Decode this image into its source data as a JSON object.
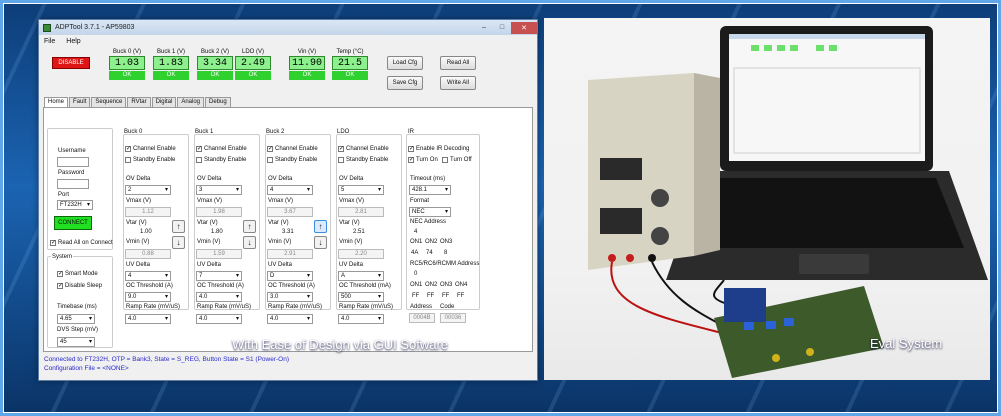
{
  "window": {
    "title": "ADPTool 3.7.1 - AP59803"
  },
  "menu": [
    "File",
    "Help"
  ],
  "top": {
    "disable_label": "DISABLE",
    "meters": [
      {
        "label": "Buck 0 (V)",
        "value": "1.03",
        "status": "OK"
      },
      {
        "label": "Buck 1 (V)",
        "value": "1.83",
        "status": "OK"
      },
      {
        "label": "Buck 2 (V)",
        "value": "3.34",
        "status": "OK"
      },
      {
        "label": "LDO (V)",
        "value": "2.49",
        "status": "OK"
      },
      {
        "label": "Vin (V)",
        "value": "11.90",
        "status": "OK"
      },
      {
        "label": "Temp (°C)",
        "value": "21.5",
        "status": "OK"
      }
    ],
    "load_cfg": "Load Cfg",
    "save_cfg": "Save Cfg",
    "read_all": "Read All",
    "write_all": "Write All"
  },
  "tabs": [
    "Home",
    "Fault",
    "Sequence",
    "RVtar",
    "Digital",
    "Analog",
    "Debug"
  ],
  "conn": {
    "username": "Username",
    "password": "Password",
    "port_label": "Port",
    "port_value": "FT232H",
    "connect": "CONNECT",
    "read_all_on_connect": "Read All on Connect"
  },
  "system": {
    "title": "System",
    "smart_mode": "Smart Mode",
    "disable_sleep": "Disable Sleep",
    "timebase_label": "Timebase (ms)",
    "timebase_value": "4.65",
    "dvs_label": "DVS Step (mV)",
    "dvs_value": "45"
  },
  "channels": [
    {
      "name": "Buck 0",
      "ov": "2",
      "vmax": "1.12",
      "vtar": "1.00",
      "vmin": "0.88",
      "uv": "4",
      "oc_label": "OC Threshold (A)",
      "oc": "9.0",
      "ramp": "4.0"
    },
    {
      "name": "Buck 1",
      "ov": "3",
      "vmax": "1.98",
      "vtar": "1.80",
      "vmin": "1.59",
      "uv": "7",
      "oc_label": "OC Threshold (A)",
      "oc": "4.0",
      "ramp": "4.0"
    },
    {
      "name": "Buck 2",
      "ov": "4",
      "vmax": "3.67",
      "vtar": "3.31",
      "vmin": "2.91",
      "uv": "D",
      "oc_label": "OC Threshold (A)",
      "oc": "3.0",
      "ramp": "4.0"
    },
    {
      "name": "LDO",
      "ov": "5",
      "vmax": "2.81",
      "vtar": "2.51",
      "vmin": "2.20",
      "uv": "A",
      "oc_label": "OC Threshold (mA)",
      "oc": "500",
      "ramp": "4.0"
    }
  ],
  "channel_labels": {
    "enable": "Channel Enable",
    "standby": "Standby Enable",
    "ov": "OV Delta",
    "vmax": "Vmax (V)",
    "vtar": "Vtar (V)",
    "vmin": "Vmin (V)",
    "uv": "UV Delta",
    "ramp": "Ramp Rate (mV/uS)"
  },
  "ir": {
    "title": "IR",
    "enable": "Enable IR Decoding",
    "turn_on": "Turn On",
    "turn_off": "Turn Off",
    "timeout_label": "Timeout (ms)",
    "timeout_value": "428.1",
    "format_label": "Format",
    "format_value": "NEC",
    "nec_label": "NEC Address",
    "nec_value": "4",
    "on_labels": [
      "ON1",
      "ON2",
      "ON3"
    ],
    "on_values": [
      "4A",
      "74",
      "8"
    ],
    "rc5_label": "RC5/RC6/RCMM Address",
    "rc5_value": "0",
    "on4_labels": [
      "ON1",
      "ON2",
      "ON3",
      "ON4"
    ],
    "on4_values": [
      "FF",
      "FF",
      "FF",
      "FF"
    ],
    "address_label": "Address",
    "code_label": "Code",
    "address_value": "0004B",
    "code_value": "00036"
  },
  "status": {
    "line1": "Connected to FT232H, OTP = Bank3, State = S_REG, Button State = S1 (Power-On)",
    "line2": "Configuration File = <NONE>"
  },
  "captions": {
    "left": "With Ease of  Design via GUI Sofware",
    "right": "Eval System"
  },
  "colors": {
    "meter_bg": "#8cf08c",
    "ok_bg": "#2fd12f",
    "disable_bg": "#e01515",
    "connect_bg": "#21e021",
    "status_text": "#2a2acc"
  }
}
